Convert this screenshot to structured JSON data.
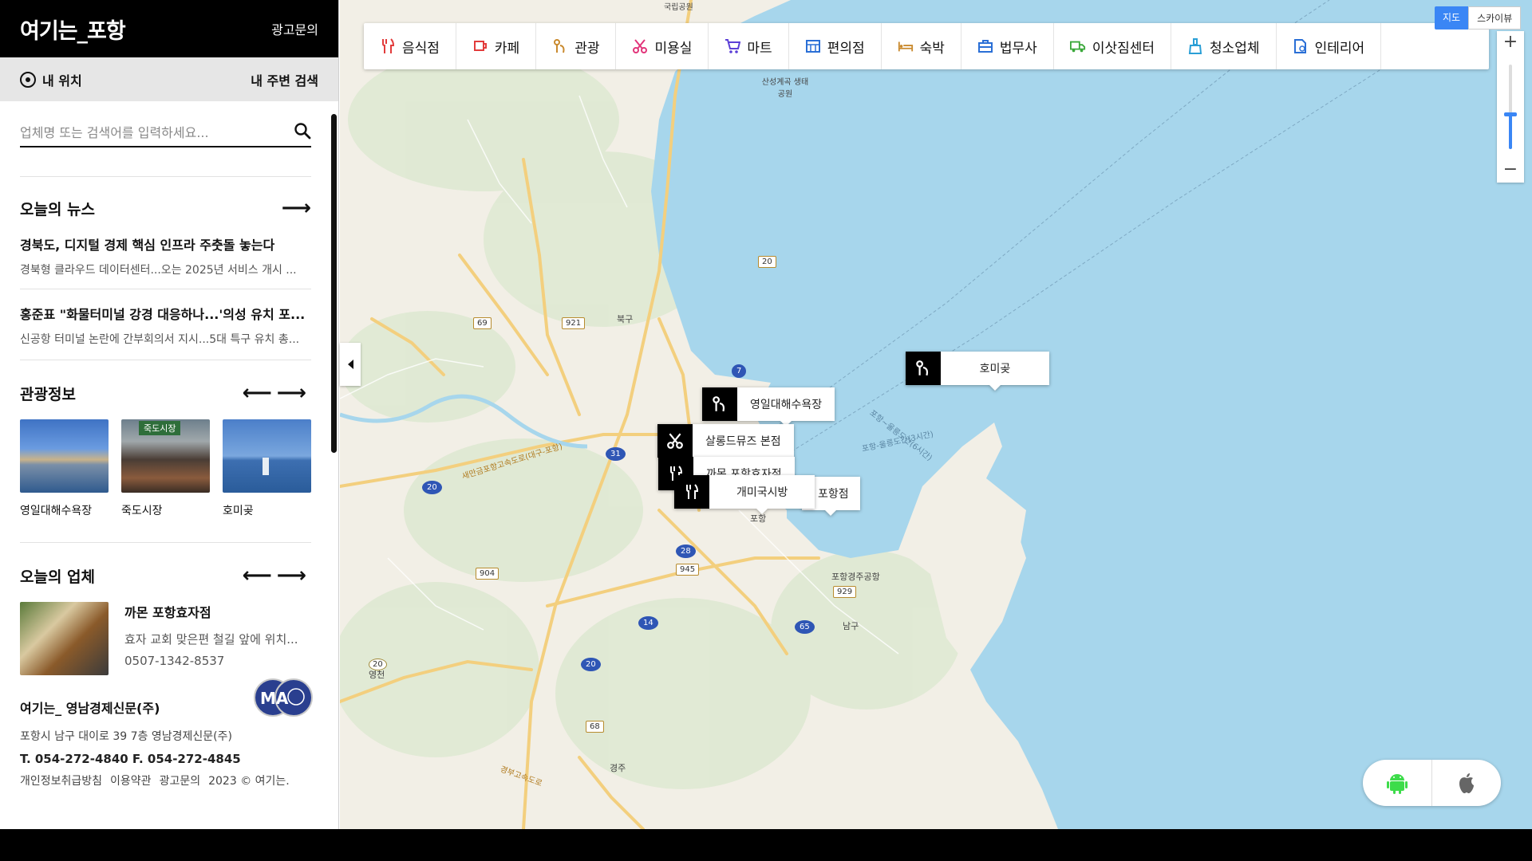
{
  "sidebar": {
    "brand": "여기는_포항",
    "ad_link": "광고문의",
    "my_location": "내 위치",
    "nearby_search": "내 주변 검색",
    "search_placeholder": "업체명 또는 검색어를 입력하세요...",
    "news": {
      "title": "오늘의 뉴스",
      "items": [
        {
          "title": "경북도, 디지털 경제 핵심 인프라 주춧돌 놓는다",
          "summary": "경북형 클라우드 데이터센터...오는 2025년 서비스 개시 ..."
        },
        {
          "title": "홍준표 \"화물터미널 강경 대응하나...'의성 유치 포...",
          "summary": "신공항 터미널 논란에 간부회의서 지시...5대 특구 유치 총..."
        }
      ]
    },
    "tourism": {
      "title": "관광정보",
      "items": [
        {
          "caption": "영일대해수욕장"
        },
        {
          "caption": "죽도시장",
          "sign": "죽도시장"
        },
        {
          "caption": "호미곶"
        }
      ]
    },
    "business": {
      "title": "오늘의 업체",
      "name": "까몬 포항효자점",
      "desc": "효자 교회 맞은편 철길 앞에 위치...",
      "tel": "0507-1342-8537"
    },
    "footer": {
      "company": "여기는_ 영남경제신문(주)",
      "address": "포항시 남구 대이로 39 7층 영남경제신문(주)",
      "tel": "T. 054-272-4840 F. 054-272-4845",
      "links": [
        "개인정보취급방침",
        "이용약관",
        "광고문의",
        "2023 © 여기는."
      ],
      "logo_text": "MA"
    }
  },
  "map": {
    "categories": [
      {
        "label": "음식점",
        "icon": "fork-knife-icon",
        "color": "#e23b3b"
      },
      {
        "label": "카페",
        "icon": "cup-icon",
        "color": "#e23b3b"
      },
      {
        "label": "관광",
        "icon": "tour-icon",
        "color": "#c98a2e"
      },
      {
        "label": "미용실",
        "icon": "scissors-icon",
        "color": "#e2357a"
      },
      {
        "label": "마트",
        "icon": "cart-icon",
        "color": "#5b3fd6"
      },
      {
        "label": "편의점",
        "icon": "store-icon",
        "color": "#2a6fd6"
      },
      {
        "label": "숙박",
        "icon": "bed-icon",
        "color": "#c98a2e"
      },
      {
        "label": "법무사",
        "icon": "briefcase-icon",
        "color": "#2a6fd6"
      },
      {
        "label": "이삿짐센터",
        "icon": "truck-icon",
        "color": "#3aa83a"
      },
      {
        "label": "청소업체",
        "icon": "broom-icon",
        "color": "#2a9fd6"
      },
      {
        "label": "인테리어",
        "icon": "interior-icon",
        "color": "#2a6fd6"
      }
    ],
    "map_type": {
      "map": "지도",
      "skyview": "스카이뷰"
    },
    "zoom_in": "+",
    "zoom_out": "−",
    "markers": [
      {
        "label": "호미곶",
        "icon": "tour-icon"
      },
      {
        "label": "영일대해수욕장",
        "icon": "tour-icon"
      },
      {
        "label": "살롱드뮤즈 본점",
        "icon": "scissors-icon"
      },
      {
        "label": "까몬 포항효자점",
        "icon": "fork-knife-icon"
      },
      {
        "label": "개미국시방",
        "icon": "fork-knife-icon"
      },
      {
        "label": "포항점",
        "icon": "none"
      }
    ],
    "place_labels": [
      "북구",
      "남구",
      "포항",
      "경주",
      "영천",
      "포항경주공항",
      "산성계곡 생태공원",
      "국립공원"
    ],
    "route_numbers": [
      "20",
      "69",
      "921",
      "7",
      "31",
      "20",
      "28",
      "945",
      "904",
      "14",
      "20",
      "65",
      "929",
      "68",
      "20"
    ],
    "sea_route_labels": [
      "포항-울릉도간(3시간)",
      "포항~울릉도간(6시간)"
    ],
    "highway_labels": [
      "새만금포항고속도로(대구-포항)",
      "경부고속도로"
    ],
    "app_buttons": [
      "android-icon",
      "apple-icon"
    ],
    "colors": {
      "sea": "#a7d6ec",
      "land": "#f2efe6",
      "forest": "#dfe9d3",
      "road": "#f3cf7e",
      "accent": "#3a86f5"
    }
  }
}
